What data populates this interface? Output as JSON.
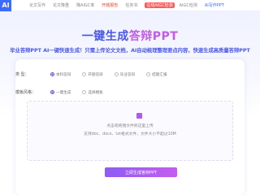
{
  "nav": {
    "logo": "AI",
    "items": [
      "论文写作",
      "论文降重",
      "降AIGC率",
      "开题报告",
      "任务书",
      "在线AIGC检测",
      "AIGC检测",
      "AI写作PPT"
    ]
  },
  "hero": {
    "title_part1": "一键生成",
    "title_part2": "答辩PPT",
    "subtitle": "毕业答辩PPT AI一键快速生成！只需上传论文文档，AI自动梳理整理要点内容，快速生成高质量答辩PPT"
  },
  "form": {
    "type_label": "类 型：",
    "type_options": [
      {
        "label": "本科答辩",
        "selected": true
      },
      {
        "label": "开题答辩",
        "selected": false
      },
      {
        "label": "毕业答辩",
        "selected": false
      },
      {
        "label": "结题汇报",
        "selected": false
      }
    ],
    "style_label": "模板风格：",
    "style_options": [
      {
        "label": "一键生成",
        "selected": true
      },
      {
        "label": "选择模板",
        "selected": false
      }
    ],
    "upload_line1": "点击或拖拽文件到这里上传",
    "upload_line2": "支持doc、docx、txt格式文件，文件大小不超过10M",
    "submit_label": "立即生成答辩PPT"
  }
}
